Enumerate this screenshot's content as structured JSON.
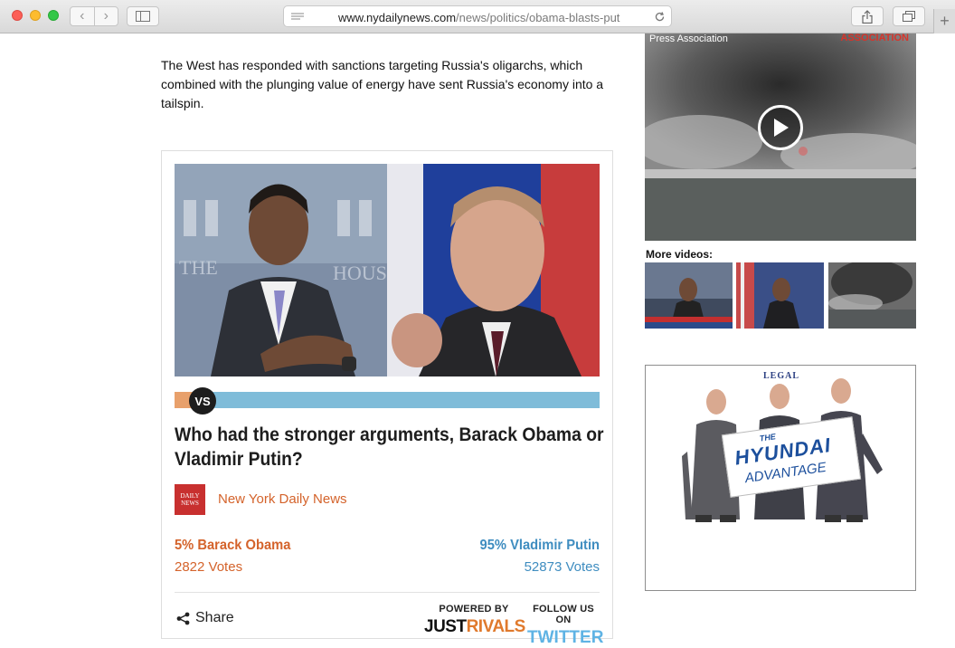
{
  "browser": {
    "url_domain": "www.nydailynews.com",
    "url_path": "/news/politics/obama-blasts-put",
    "new_tab_label": "+"
  },
  "article": {
    "paragraph": "The West has responded with sanctions targeting Russia's oligarchs, which combined with the plunging value of energy have sent Russia's economy into a tailspin."
  },
  "poll": {
    "vs_label": "VS",
    "question": "Who had the stronger arguments, Barack Obama or Vladimir Putin?",
    "source_logo_line1": "DAILY",
    "source_logo_line2": "NEWS",
    "source_name": "New York Daily News",
    "left": {
      "percent_name": "5% Barack Obama",
      "votes": "2822 Votes"
    },
    "right": {
      "percent_name": "95% Vladimir Putin",
      "votes": "52873 Votes"
    },
    "left_share": 0.05,
    "share_label": "Share",
    "powered_by_label": "POWERED BY",
    "powered_by_brand_a": "JUST",
    "powered_by_brand_b": "RIVALS",
    "follow_label": "FOLLOW US ON",
    "follow_brand": "TWITTER"
  },
  "video": {
    "caption_left": "Press Association",
    "caption_right": "ASSOCIATION"
  },
  "more_videos": {
    "label": "More videos:"
  },
  "ad": {
    "top_text": "LEGAL",
    "sign_the": "THE",
    "sign_brand": "HYUNDAI",
    "sign_sub": "ADVANTAGE"
  },
  "colors": {
    "obama_orange": "#d4632b",
    "putin_blue": "#3f8dc0",
    "vs_bar_blue": "#7fbcd9",
    "vs_bar_orange": "#e8a06b"
  }
}
